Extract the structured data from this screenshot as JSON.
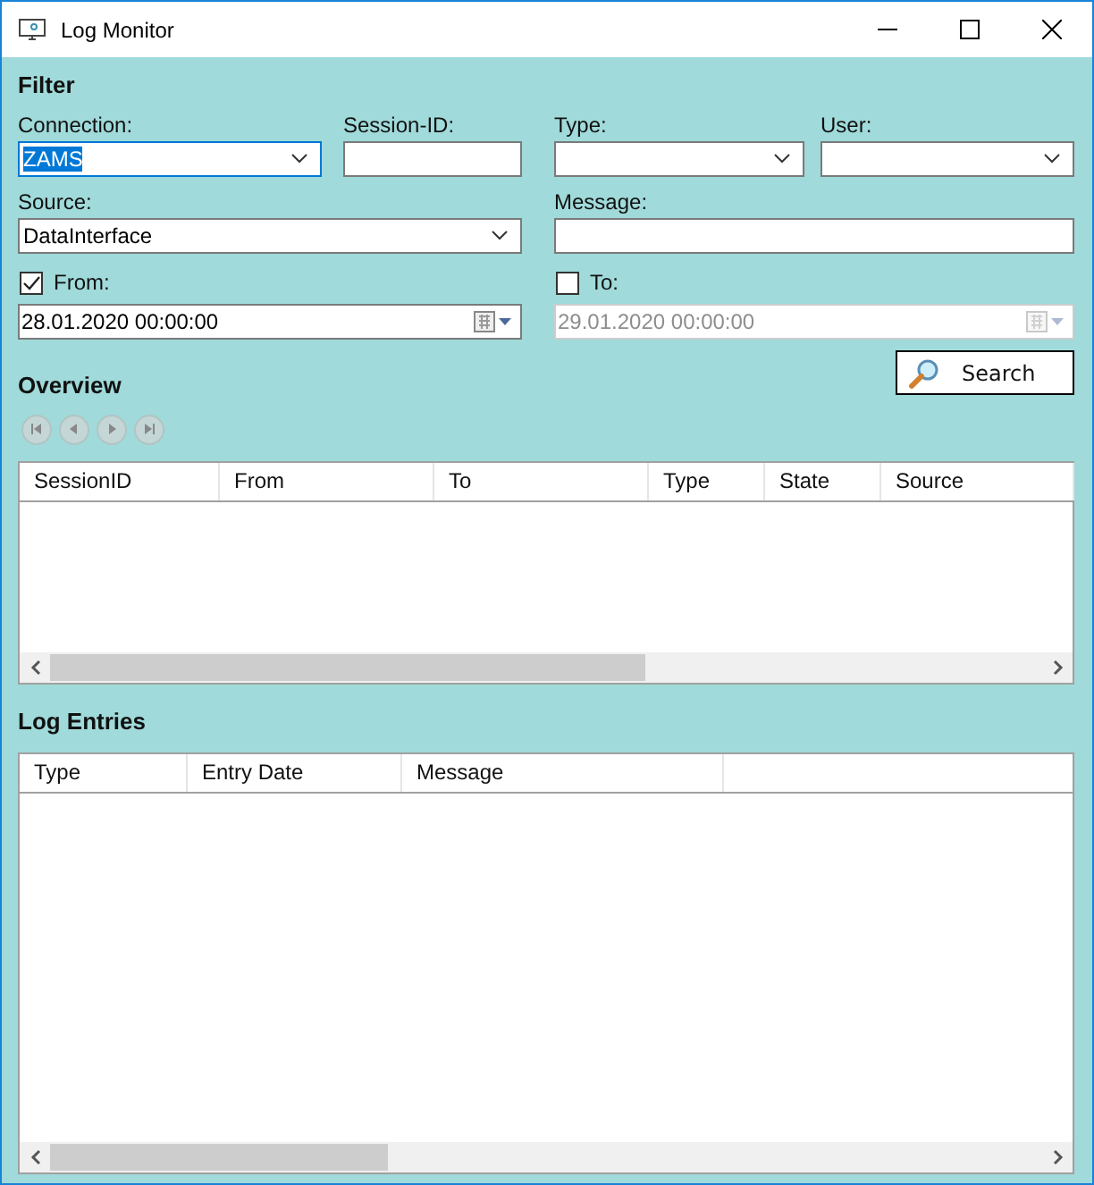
{
  "window": {
    "title": "Log Monitor"
  },
  "filter": {
    "heading": "Filter",
    "fields": [
      {
        "label": "Connection:",
        "kind": "combo",
        "value": "ZAMS",
        "focused": true
      },
      {
        "label": "Session-ID:",
        "kind": "text",
        "focused": false
      },
      {
        "label": "Type:",
        "kind": "combo",
        "focused": false
      },
      {
        "label": "User:",
        "kind": "combo",
        "focused": false
      },
      {
        "label": "Source:",
        "kind": "combo",
        "value": "DataInterface",
        "focused": false
      },
      {
        "label": "Message:",
        "kind": "text",
        "focused": false
      }
    ],
    "dates": [
      {
        "label": "From:",
        "checked": true,
        "value": "28.01.2020 00:00:00",
        "disabled": false
      },
      {
        "label": "To:",
        "checked": false,
        "value": "29.01.2020 00:00:00",
        "disabled": true
      }
    ],
    "search_button": "Search"
  },
  "overview": {
    "heading": "Overview",
    "nav": [
      {
        "kind": "first",
        "disabled": true
      },
      {
        "kind": "prev",
        "disabled": true
      },
      {
        "kind": "next",
        "disabled": true
      },
      {
        "kind": "last",
        "disabled": true
      }
    ],
    "table": {
      "columns": [
        "SessionID",
        "From",
        "To",
        "Type",
        "State",
        "Source"
      ]
    }
  },
  "log_entries": {
    "heading": "Log Entries",
    "table": {
      "columns": [
        "Type",
        "Entry Date",
        "Message"
      ]
    }
  }
}
